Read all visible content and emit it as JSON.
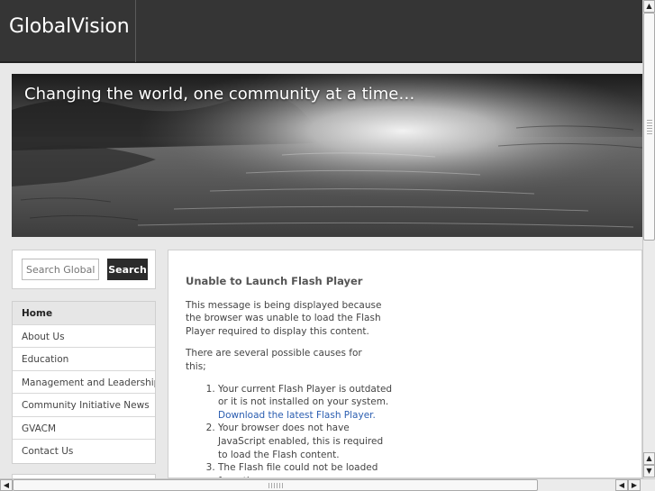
{
  "header": {
    "logo_text": "GlobalVision"
  },
  "banner": {
    "tagline": "Changing the world, one community at a time…"
  },
  "search": {
    "placeholder": "Search GlobalVision",
    "button_label": "Search"
  },
  "nav": {
    "items": [
      {
        "label": "Home",
        "active": true
      },
      {
        "label": "About Us"
      },
      {
        "label": "Education"
      },
      {
        "label": "Management and Leadership"
      },
      {
        "label": "Community Initiative News"
      },
      {
        "label": "GVACM"
      },
      {
        "label": "Contact Us"
      }
    ]
  },
  "flash_notice": {
    "heading": "Unable to Launch Flash Player",
    "para1": "This message is being displayed because the browser was unable to load the Flash Player required to display this content.",
    "para2": "There are several possible causes for this;",
    "causes": [
      {
        "text": "Your current Flash Player is outdated or it is not installed on your system.",
        "link": "Download the latest Flash Player."
      },
      {
        "text": "Your browser does not have JavaScript enabled, this is required to load the Flash content."
      },
      {
        "text": "The Flash file could not be loaded from the server."
      }
    ]
  },
  "colors": {
    "header_bg": "#353535",
    "link": "#2a5db0",
    "search_button_bg": "#2b2b2b"
  },
  "icons": {
    "scroll_up": "▲",
    "scroll_down": "▼",
    "scroll_left": "◀",
    "scroll_right": "▶"
  }
}
